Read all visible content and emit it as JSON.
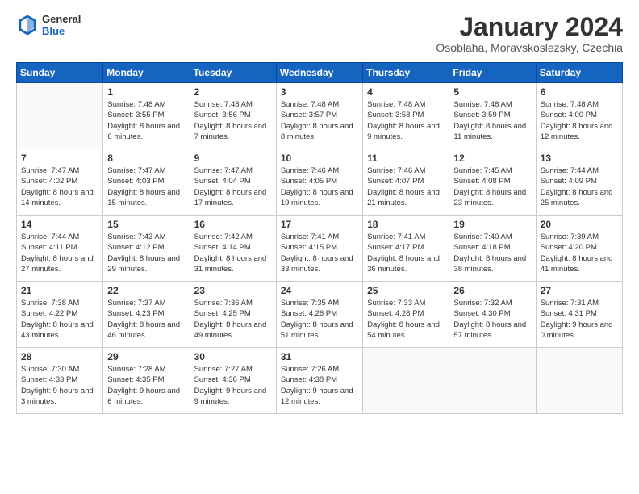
{
  "header": {
    "logo": {
      "general": "General",
      "blue": "Blue"
    },
    "title": "January 2024",
    "location": "Osoblaha, Moravskoslezsky, Czechia"
  },
  "weekdays": [
    "Sunday",
    "Monday",
    "Tuesday",
    "Wednesday",
    "Thursday",
    "Friday",
    "Saturday"
  ],
  "weeks": [
    [
      {
        "day": "",
        "sunrise": "",
        "sunset": "",
        "daylight": ""
      },
      {
        "day": "1",
        "sunrise": "Sunrise: 7:48 AM",
        "sunset": "Sunset: 3:55 PM",
        "daylight": "Daylight: 8 hours and 6 minutes."
      },
      {
        "day": "2",
        "sunrise": "Sunrise: 7:48 AM",
        "sunset": "Sunset: 3:56 PM",
        "daylight": "Daylight: 8 hours and 7 minutes."
      },
      {
        "day": "3",
        "sunrise": "Sunrise: 7:48 AM",
        "sunset": "Sunset: 3:57 PM",
        "daylight": "Daylight: 8 hours and 8 minutes."
      },
      {
        "day": "4",
        "sunrise": "Sunrise: 7:48 AM",
        "sunset": "Sunset: 3:58 PM",
        "daylight": "Daylight: 8 hours and 9 minutes."
      },
      {
        "day": "5",
        "sunrise": "Sunrise: 7:48 AM",
        "sunset": "Sunset: 3:59 PM",
        "daylight": "Daylight: 8 hours and 11 minutes."
      },
      {
        "day": "6",
        "sunrise": "Sunrise: 7:48 AM",
        "sunset": "Sunset: 4:00 PM",
        "daylight": "Daylight: 8 hours and 12 minutes."
      }
    ],
    [
      {
        "day": "7",
        "sunrise": "Sunrise: 7:47 AM",
        "sunset": "Sunset: 4:02 PM",
        "daylight": "Daylight: 8 hours and 14 minutes."
      },
      {
        "day": "8",
        "sunrise": "Sunrise: 7:47 AM",
        "sunset": "Sunset: 4:03 PM",
        "daylight": "Daylight: 8 hours and 15 minutes."
      },
      {
        "day": "9",
        "sunrise": "Sunrise: 7:47 AM",
        "sunset": "Sunset: 4:04 PM",
        "daylight": "Daylight: 8 hours and 17 minutes."
      },
      {
        "day": "10",
        "sunrise": "Sunrise: 7:46 AM",
        "sunset": "Sunset: 4:05 PM",
        "daylight": "Daylight: 8 hours and 19 minutes."
      },
      {
        "day": "11",
        "sunrise": "Sunrise: 7:46 AM",
        "sunset": "Sunset: 4:07 PM",
        "daylight": "Daylight: 8 hours and 21 minutes."
      },
      {
        "day": "12",
        "sunrise": "Sunrise: 7:45 AM",
        "sunset": "Sunset: 4:08 PM",
        "daylight": "Daylight: 8 hours and 23 minutes."
      },
      {
        "day": "13",
        "sunrise": "Sunrise: 7:44 AM",
        "sunset": "Sunset: 4:09 PM",
        "daylight": "Daylight: 8 hours and 25 minutes."
      }
    ],
    [
      {
        "day": "14",
        "sunrise": "Sunrise: 7:44 AM",
        "sunset": "Sunset: 4:11 PM",
        "daylight": "Daylight: 8 hours and 27 minutes."
      },
      {
        "day": "15",
        "sunrise": "Sunrise: 7:43 AM",
        "sunset": "Sunset: 4:12 PM",
        "daylight": "Daylight: 8 hours and 29 minutes."
      },
      {
        "day": "16",
        "sunrise": "Sunrise: 7:42 AM",
        "sunset": "Sunset: 4:14 PM",
        "daylight": "Daylight: 8 hours and 31 minutes."
      },
      {
        "day": "17",
        "sunrise": "Sunrise: 7:41 AM",
        "sunset": "Sunset: 4:15 PM",
        "daylight": "Daylight: 8 hours and 33 minutes."
      },
      {
        "day": "18",
        "sunrise": "Sunrise: 7:41 AM",
        "sunset": "Sunset: 4:17 PM",
        "daylight": "Daylight: 8 hours and 36 minutes."
      },
      {
        "day": "19",
        "sunrise": "Sunrise: 7:40 AM",
        "sunset": "Sunset: 4:18 PM",
        "daylight": "Daylight: 8 hours and 38 minutes."
      },
      {
        "day": "20",
        "sunrise": "Sunrise: 7:39 AM",
        "sunset": "Sunset: 4:20 PM",
        "daylight": "Daylight: 8 hours and 41 minutes."
      }
    ],
    [
      {
        "day": "21",
        "sunrise": "Sunrise: 7:38 AM",
        "sunset": "Sunset: 4:22 PM",
        "daylight": "Daylight: 8 hours and 43 minutes."
      },
      {
        "day": "22",
        "sunrise": "Sunrise: 7:37 AM",
        "sunset": "Sunset: 4:23 PM",
        "daylight": "Daylight: 8 hours and 46 minutes."
      },
      {
        "day": "23",
        "sunrise": "Sunrise: 7:36 AM",
        "sunset": "Sunset: 4:25 PM",
        "daylight": "Daylight: 8 hours and 49 minutes."
      },
      {
        "day": "24",
        "sunrise": "Sunrise: 7:35 AM",
        "sunset": "Sunset: 4:26 PM",
        "daylight": "Daylight: 8 hours and 51 minutes."
      },
      {
        "day": "25",
        "sunrise": "Sunrise: 7:33 AM",
        "sunset": "Sunset: 4:28 PM",
        "daylight": "Daylight: 8 hours and 54 minutes."
      },
      {
        "day": "26",
        "sunrise": "Sunrise: 7:32 AM",
        "sunset": "Sunset: 4:30 PM",
        "daylight": "Daylight: 8 hours and 57 minutes."
      },
      {
        "day": "27",
        "sunrise": "Sunrise: 7:31 AM",
        "sunset": "Sunset: 4:31 PM",
        "daylight": "Daylight: 9 hours and 0 minutes."
      }
    ],
    [
      {
        "day": "28",
        "sunrise": "Sunrise: 7:30 AM",
        "sunset": "Sunset: 4:33 PM",
        "daylight": "Daylight: 9 hours and 3 minutes."
      },
      {
        "day": "29",
        "sunrise": "Sunrise: 7:28 AM",
        "sunset": "Sunset: 4:35 PM",
        "daylight": "Daylight: 9 hours and 6 minutes."
      },
      {
        "day": "30",
        "sunrise": "Sunrise: 7:27 AM",
        "sunset": "Sunset: 4:36 PM",
        "daylight": "Daylight: 9 hours and 9 minutes."
      },
      {
        "day": "31",
        "sunrise": "Sunrise: 7:26 AM",
        "sunset": "Sunset: 4:38 PM",
        "daylight": "Daylight: 9 hours and 12 minutes."
      },
      {
        "day": "",
        "sunrise": "",
        "sunset": "",
        "daylight": ""
      },
      {
        "day": "",
        "sunrise": "",
        "sunset": "",
        "daylight": ""
      },
      {
        "day": "",
        "sunrise": "",
        "sunset": "",
        "daylight": ""
      }
    ]
  ]
}
